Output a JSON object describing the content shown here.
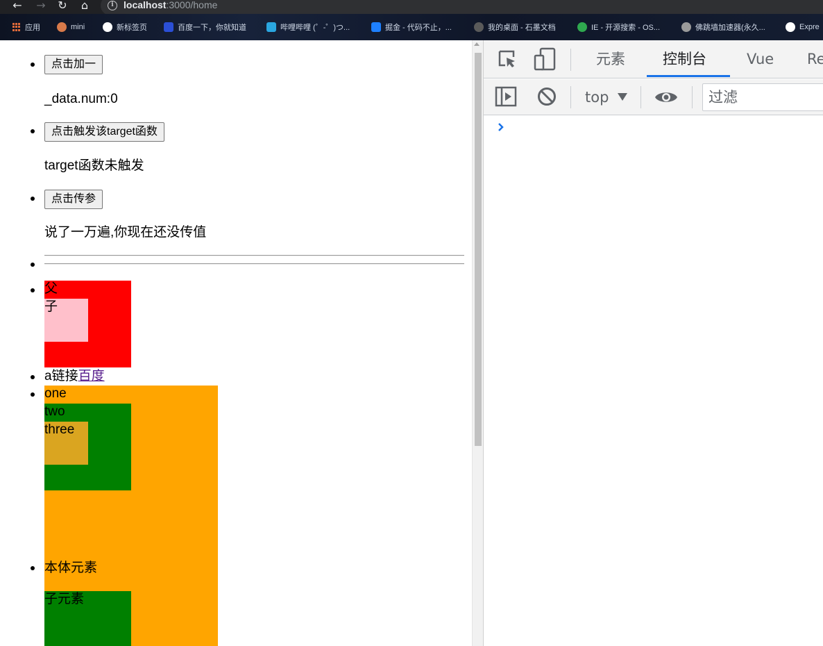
{
  "browser": {
    "url_host": "localhost",
    "url_path": ":3000/home",
    "bookmarks": [
      {
        "label": "应用",
        "color": "#e06a3a"
      },
      {
        "label": "mini",
        "color": "#d87a4a"
      },
      {
        "label": "新标签页",
        "color": "#ffffff"
      },
      {
        "label": "百度一下，你就知道",
        "color": "#2b4fd6"
      },
      {
        "label": "哔哩哔哩 (゜-゜)つ...",
        "color": "#2aa6e0"
      },
      {
        "label": "掘金 - 代码不止，...",
        "color": "#1e80ff"
      },
      {
        "label": "我的桌面 - 石墨文档",
        "color": "#5a5a5a"
      },
      {
        "label": "IE - 开源搜索 - OS...",
        "color": "#2fa84f"
      },
      {
        "label": "佛跳墙加速器(永久...",
        "color": "#9a9a9a"
      },
      {
        "label": "Expre",
        "color": "#ffffff"
      }
    ]
  },
  "page": {
    "add_button": "点击加一",
    "num_text": "_data.num:0",
    "target_button": "点击触发该target函数",
    "target_text": "target函数未触发",
    "param_button": "点击传参",
    "param_text": "说了一万遍,你现在还没传值",
    "parent_label": "父",
    "child_label": "子",
    "link_prefix": "a链接",
    "link_text": "百度",
    "one_label": "one",
    "two_label": "two",
    "three_label": "three",
    "body_label": "本体元素",
    "sub_label": "子元素",
    "colors": {
      "parent": "#ff0000",
      "child": "#ffc0cb",
      "one": "#ffa500",
      "two": "#008000",
      "three": "#daa520"
    }
  },
  "devtools": {
    "tabs": [
      "元素",
      "控制台",
      "Vue",
      "Re"
    ],
    "active_tab": "控制台",
    "context": "top",
    "filter_placeholder": "过滤",
    "accent": "#1a73e8"
  }
}
